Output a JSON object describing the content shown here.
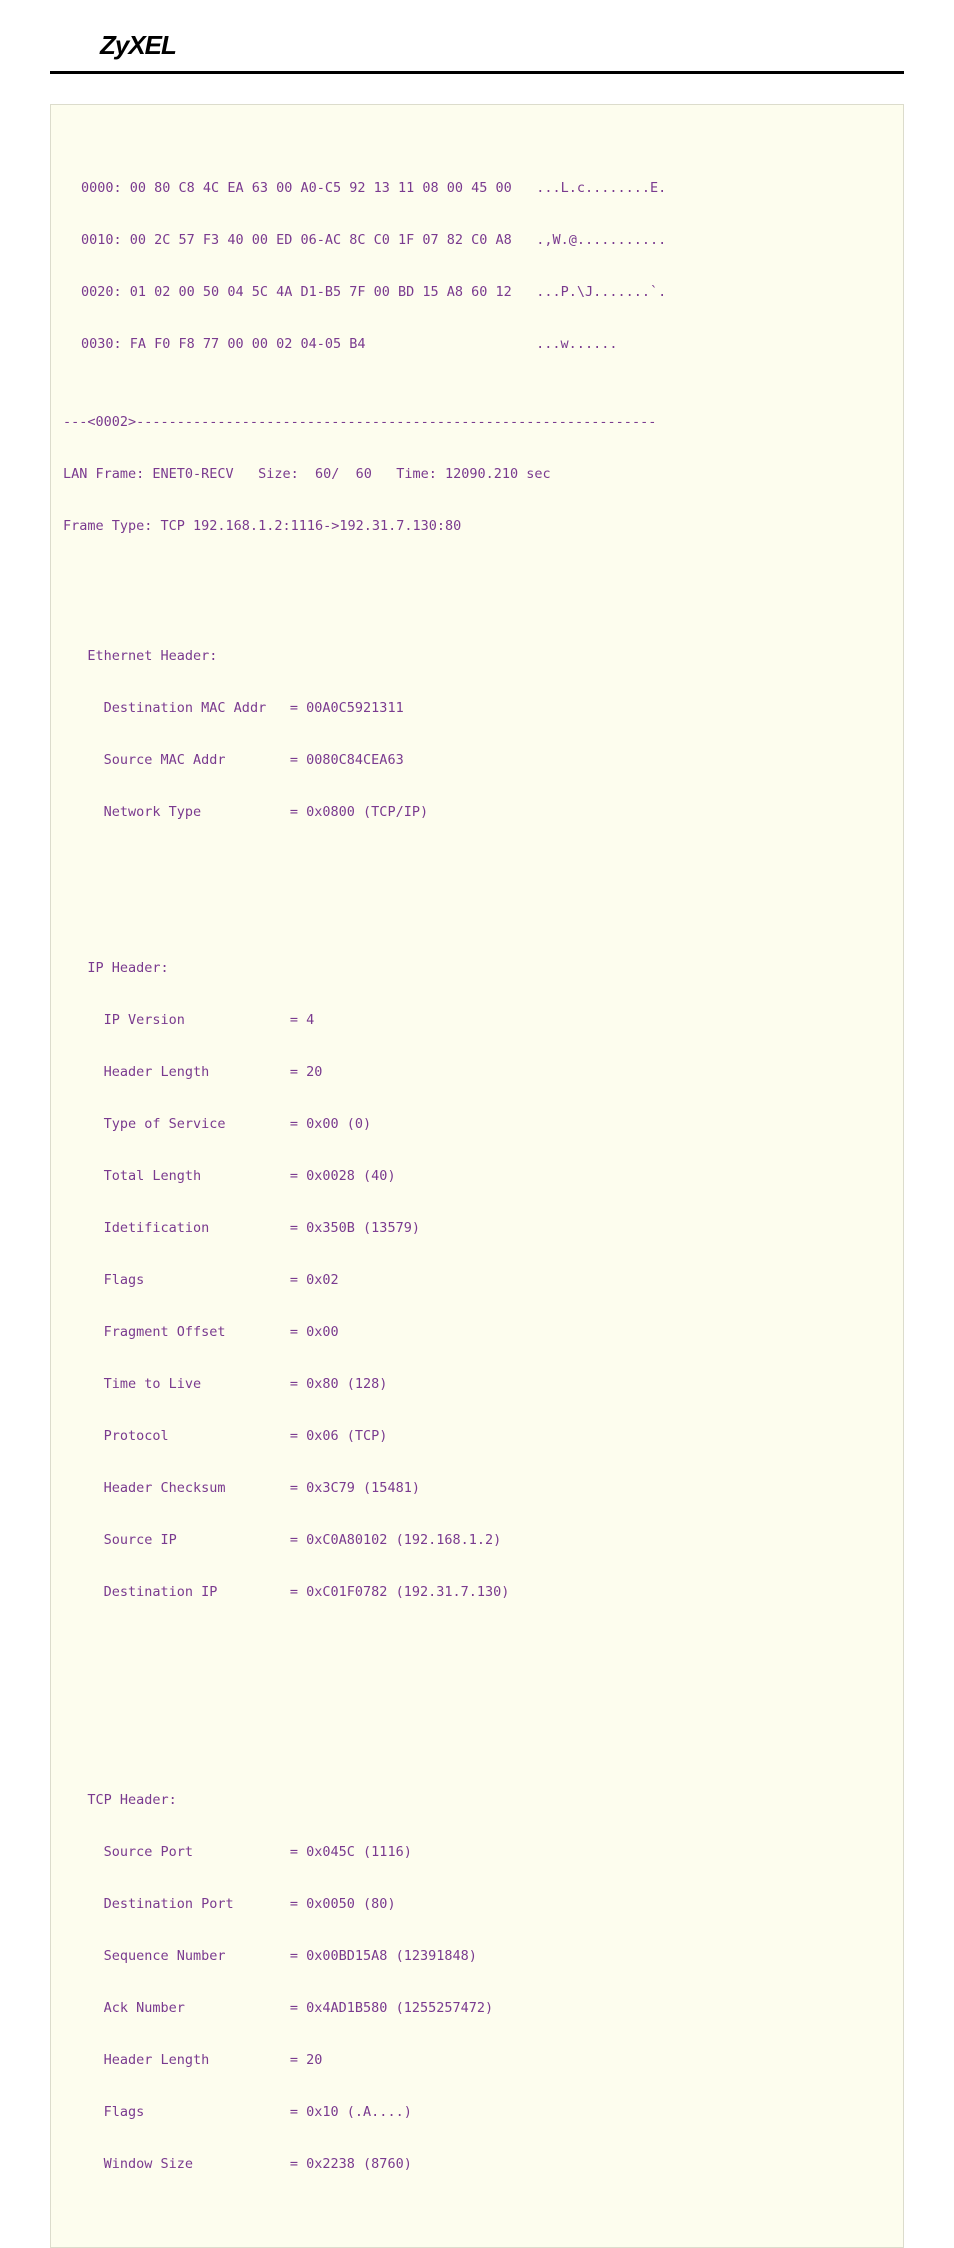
{
  "brand": "ZyXEL",
  "hex": {
    "l0_off": "0000:",
    "l0_bytes": "00 80 C8 4C EA 63 00 A0-C5 92 13 11 08 00 45 00",
    "l0_ascii": "...L.c........E.",
    "l1_off": "0010:",
    "l1_bytes": "00 2C 57 F3 40 00 ED 06-AC 8C C0 1F 07 82 C0 A8",
    "l1_ascii": ".,W.@...........",
    "l2_off": "0020:",
    "l2_bytes": "01 02 00 50 04 5C 4A D1-B5 7F 00 BD 15 A8 60 12",
    "l2_ascii": "...P.\\J.......`.",
    "l3_off": "0030:",
    "l3_bytes": "FA F0 F8 77 00 00 02 04-05 B4",
    "l3_ascii": "...w......"
  },
  "divider": "---<0002>----------------------------------------------------------------",
  "meta": {
    "lan": "LAN Frame: ENET0-RECV   Size:  60/  60   Time: 12090.210 sec",
    "type": "Frame Type: TCP 192.168.1.2:1116->192.31.7.130:80"
  },
  "eth": {
    "title": "Ethernet Header:",
    "dst_k": "Destination MAC Addr",
    "dst_v": "= 00A0C5921311",
    "src_k": "Source MAC Addr",
    "src_v": "= 0080C84CEA63",
    "net_k": "Network Type",
    "net_v": "= 0x0800 (TCP/IP)"
  },
  "ip": {
    "title": "IP Header:",
    "ver_k": "IP Version",
    "ver_v": "= 4",
    "hl_k": "Header Length",
    "hl_v": "= 20",
    "tos_k": "Type of Service",
    "tos_v": "= 0x00 (0)",
    "tl_k": "Total Length",
    "tl_v": "= 0x0028 (40)",
    "id_k": "Idetification",
    "id_v": "= 0x350B (13579)",
    "fl_k": "Flags",
    "fl_v": "= 0x02",
    "fo_k": "Fragment Offset",
    "fo_v": "= 0x00",
    "ttl_k": "Time to Live",
    "ttl_v": "= 0x80 (128)",
    "pr_k": "Protocol",
    "pr_v": "= 0x06 (TCP)",
    "ck_k": "Header Checksum",
    "ck_v": "= 0x3C79 (15481)",
    "sip_k": "Source IP",
    "sip_v": "= 0xC0A80102 (192.168.1.2)",
    "dip_k": "Destination IP",
    "dip_v": "= 0xC01F0782 (192.31.7.130)"
  },
  "tcp": {
    "title": "TCP Header:",
    "sp_k": "Source Port",
    "sp_v": "= 0x045C (1116)",
    "dp_k": "Destination Port",
    "dp_v": "= 0x0050 (80)",
    "seq_k": "Sequence Number",
    "seq_v": "= 0x00BD15A8 (12391848)",
    "ack_k": "Ack Number",
    "ack_v": "= 0x4AD1B580 (1255257472)",
    "hl_k": "Header Length",
    "hl_v": "= 20",
    "fl_k": "Flags",
    "fl_v": "= 0x10 (.A....)",
    "ws_k": "Window Size",
    "ws_v": "= 0x2238 (8760)"
  }
}
